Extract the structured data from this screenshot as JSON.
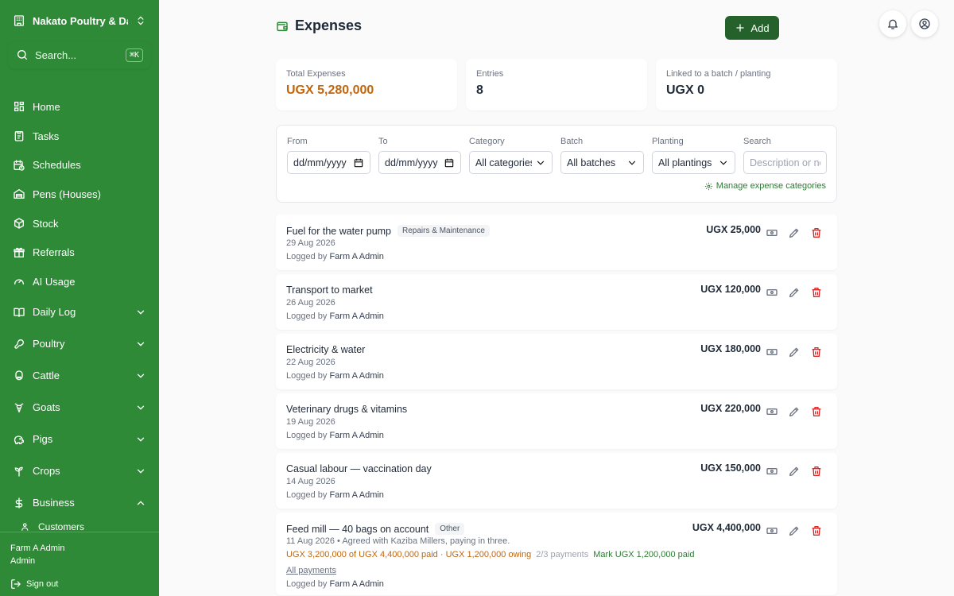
{
  "sidebar": {
    "farm_name": "Nakato Poultry & Da...",
    "search_placeholder": "Search...",
    "search_shortcut": "⌘K",
    "items": [
      {
        "label": "Home",
        "icon": "grid-icon"
      },
      {
        "label": "Tasks",
        "icon": "clipboard-icon"
      },
      {
        "label": "Schedules",
        "icon": "calendar-clock-icon"
      },
      {
        "label": "Pens (Houses)",
        "icon": "warehouse-icon"
      },
      {
        "label": "Stock",
        "icon": "box-icon"
      },
      {
        "label": "Referrals",
        "icon": "gift-icon"
      },
      {
        "label": "AI Usage",
        "icon": "gauge-icon"
      }
    ],
    "groups": [
      {
        "label": "Daily Log",
        "icon": "book-icon",
        "expanded": false
      },
      {
        "label": "Poultry",
        "icon": "drumstick-icon",
        "expanded": false
      },
      {
        "label": "Cattle",
        "icon": "cattle-icon",
        "expanded": false
      },
      {
        "label": "Goats",
        "icon": "goat-icon",
        "expanded": false
      },
      {
        "label": "Pigs",
        "icon": "pig-icon",
        "expanded": false
      },
      {
        "label": "Crops",
        "icon": "sprout-icon",
        "expanded": false
      },
      {
        "label": "Business",
        "icon": "dollar-icon",
        "expanded": true
      }
    ],
    "sub_items": [
      {
        "label": "Customers"
      }
    ],
    "user_name": "Farm A Admin",
    "user_role": "Admin",
    "sign_out": "Sign out"
  },
  "header": {
    "title": "Expenses",
    "add_label": "Add"
  },
  "stats": [
    {
      "label": "Total Expenses",
      "value": "UGX 5,280,000",
      "accent": "#c0660f"
    },
    {
      "label": "Entries",
      "value": "8"
    },
    {
      "label": "Linked to a batch / planting",
      "value": "UGX 0"
    }
  ],
  "filters": {
    "from_label": "From",
    "from_value": "dd/mm/yyyy",
    "to_label": "To",
    "to_value": "dd/mm/yyyy",
    "category_label": "Category",
    "category_value": "All categories",
    "batch_label": "Batch",
    "batch_value": "All batches",
    "planting_label": "Planting",
    "planting_value": "All plantings",
    "search_label": "Search",
    "search_placeholder": "Description or notes",
    "manage_link": "Manage expense categories"
  },
  "expenses": [
    {
      "title": "Fuel for the water pump",
      "tag": "Repairs & Maintenance",
      "date": "29 Aug 2026",
      "logged_prefix": "Logged by",
      "logged_by": "Farm A Admin",
      "amount": "UGX 25,000"
    },
    {
      "title": "Transport to market",
      "date": "26 Aug 2026",
      "logged_prefix": "Logged by",
      "logged_by": "Farm A Admin",
      "amount": "UGX 120,000"
    },
    {
      "title": "Electricity & water",
      "date": "22 Aug 2026",
      "logged_prefix": "Logged by",
      "logged_by": "Farm A Admin",
      "amount": "UGX 180,000"
    },
    {
      "title": "Veterinary drugs & vitamins",
      "date": "19 Aug 2026",
      "logged_prefix": "Logged by",
      "logged_by": "Farm A Admin",
      "amount": "UGX 220,000"
    },
    {
      "title": "Casual labour — vaccination day",
      "date": "14 Aug 2026",
      "logged_prefix": "Logged by",
      "logged_by": "Farm A Admin",
      "amount": "UGX 150,000"
    },
    {
      "title": "Feed mill — 40 bags on account",
      "tag": "Other",
      "date": "11 Aug 2026 • Agreed with Kaziba Millers, paying in three.",
      "logged_prefix": "Logged by",
      "logged_by": "Farm A Admin",
      "amount": "UGX 4,400,000",
      "payment_status": "UGX 3,200,000 of UGX 4,400,000 paid · UGX 1,200,000 owing",
      "payment_count": "2/3 payments",
      "mark_paid": "Mark UGX 1,200,000 paid",
      "all_payments": "All payments"
    }
  ],
  "colors": {
    "sidebar_bg": "#2f8a37",
    "primary_button": "#24612b",
    "accent_orange": "#c0660f",
    "delete_red": "#dc2626"
  }
}
